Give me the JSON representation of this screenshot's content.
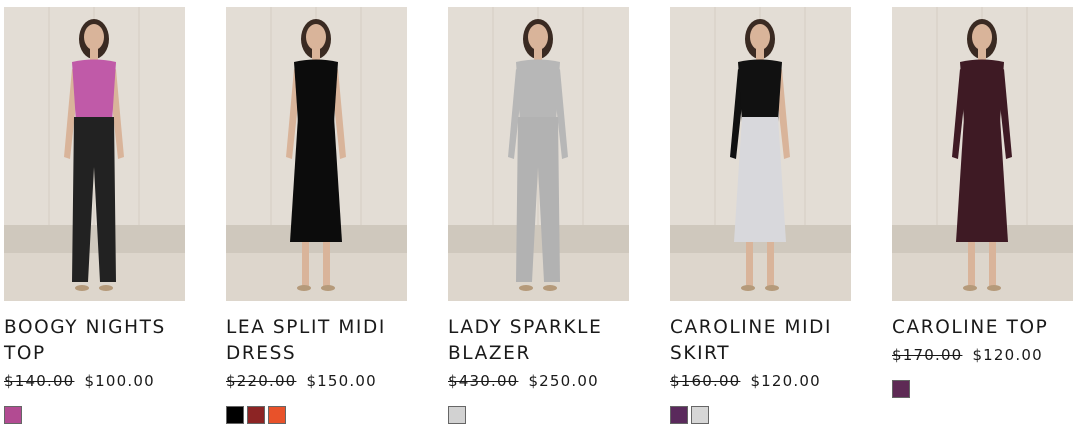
{
  "products": [
    {
      "name": "BOOGY NIGHTS TOP",
      "old_price": "$140.00",
      "price": "$100.00",
      "swatches": [
        {
          "color": "#b24b92",
          "label": "pink-sequin"
        }
      ],
      "image": {
        "top": "#c05aa8",
        "bottom": "#222222",
        "skin": "#d9b49a"
      }
    },
    {
      "name": "LEA SPLIT MIDI DRESS",
      "old_price": "$220.00",
      "price": "$150.00",
      "swatches": [
        {
          "color": "#000000",
          "label": "black"
        },
        {
          "color": "#8c2424",
          "label": "burgundy"
        },
        {
          "color": "#e8522a",
          "label": "orange"
        }
      ],
      "image": {
        "top": "#0c0c0c",
        "bottom": "#0c0c0c",
        "skin": "#d9b49a"
      }
    },
    {
      "name": "LADY SPARKLE BLAZER",
      "old_price": "$430.00",
      "price": "$250.00",
      "swatches": [
        {
          "color": "#d2d2d2",
          "label": "silver"
        }
      ],
      "image": {
        "top": "#b7b7b7",
        "bottom": "#b2b2b2",
        "skin": "#d9b49a"
      }
    },
    {
      "name": "CAROLINE MIDI SKIRT",
      "old_price": "$160.00",
      "price": "$120.00",
      "swatches": [
        {
          "color": "#5a2a5c",
          "label": "plum"
        },
        {
          "color": "#d6d6d6",
          "label": "silver"
        }
      ],
      "image": {
        "top": "#111111",
        "bottom": "#d8d8dc",
        "skin": "#d9b49a"
      }
    },
    {
      "name": "CAROLINE TOP",
      "old_price": "$170.00",
      "price": "$120.00",
      "swatches": [
        {
          "color": "#5e2a55",
          "label": "plum"
        }
      ],
      "image": {
        "top": "#3e1a24",
        "bottom": "#3e1a24",
        "skin": "#d9b49a"
      }
    }
  ]
}
